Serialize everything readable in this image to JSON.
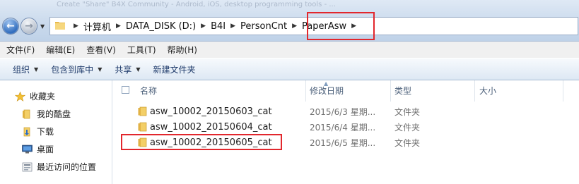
{
  "window": {
    "title_faint": "Create \"Share\" B4X Community - Android, iOS, desktop programming tools - ..."
  },
  "nav_buttons": {
    "back_icon": "arrow-left-icon",
    "forward_icon": "arrow-right-icon"
  },
  "address": {
    "crumbs": [
      "计算机",
      "DATA_DISK (D:)",
      "B4I",
      "PersonCnt",
      "PaperAsw"
    ]
  },
  "menubar": {
    "file": "文件(F)",
    "edit": "编辑(E)",
    "view": "查看(V)",
    "tools": "工具(T)",
    "help": "帮助(H)"
  },
  "toolbar": {
    "organize": "组织",
    "include_library": "包含到库中",
    "share": "共享",
    "new_folder": "新建文件夹"
  },
  "nav_pane": {
    "favorites": "收藏夹",
    "items": [
      "我的酷盘",
      "下载",
      "桌面",
      "最近访问的位置"
    ]
  },
  "columns": {
    "name": "名称",
    "modified": "修改日期",
    "type": "类型",
    "size": "大小"
  },
  "files": [
    {
      "name": "asw_10002_20150603_cat",
      "modified": "2015/6/3 星期...",
      "type": "文件夹"
    },
    {
      "name": "asw_10002_20150604_cat",
      "modified": "2015/6/4 星期...",
      "type": "文件夹"
    },
    {
      "name": "asw_10002_20150605_cat",
      "modified": "2015/6/5 星期...",
      "type": "文件夹"
    }
  ],
  "colors": {
    "highlight_box": "#e2272d",
    "folder": "#f0c65a"
  }
}
